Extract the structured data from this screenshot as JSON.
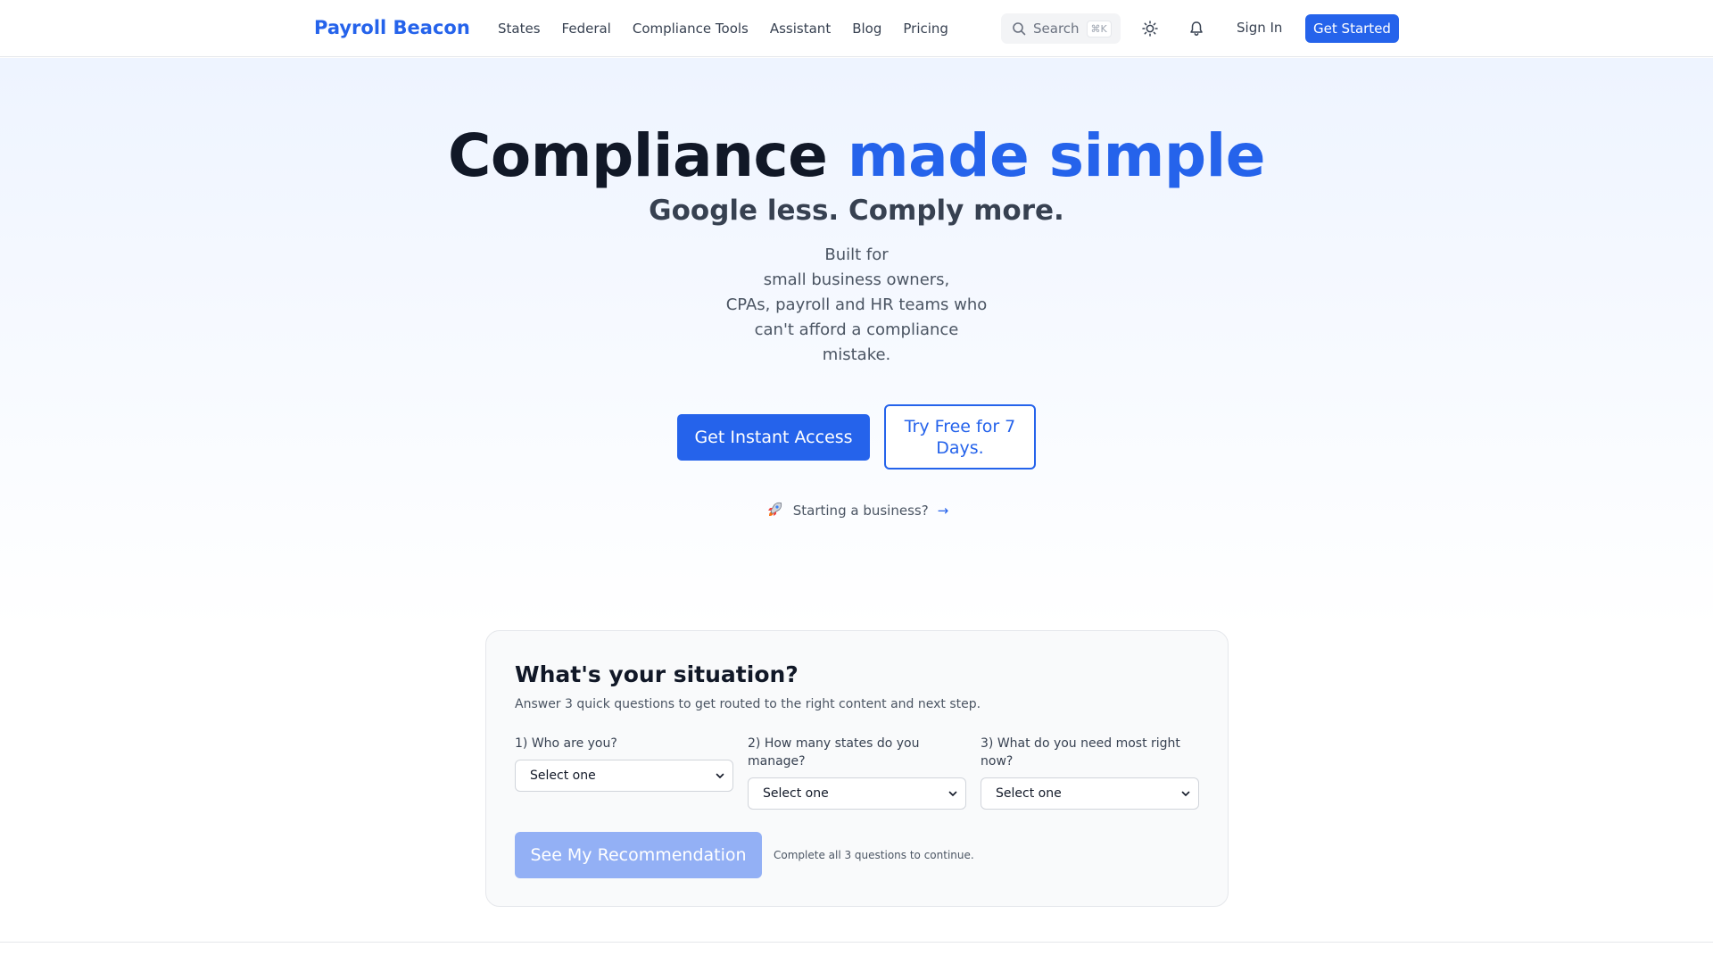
{
  "header": {
    "logo": "Payroll Beacon",
    "nav": [
      "States",
      "Federal",
      "Compliance Tools",
      "Assistant",
      "Blog",
      "Pricing"
    ],
    "search": {
      "label": "Search",
      "shortcut": "⌘K"
    },
    "icons": {
      "search": "search-icon",
      "theme": "sun-icon",
      "notifications": "bell-icon"
    },
    "sign_in": "Sign In",
    "get_started": "Get Started"
  },
  "hero": {
    "title_part1": "Compliance",
    "title_accent": "made simple",
    "subtitle": "Google less. Comply more.",
    "description_lines": [
      "Built for",
      "small business owners,",
      "CPAs, payroll and HR teams who",
      "can't afford a compliance",
      "mistake."
    ],
    "cta_primary": "Get Instant Access",
    "cta_secondary": "Try Free for 7 Days.",
    "starting_link": "Starting a business?",
    "starting_arrow": "→",
    "starting_icon": "rocket-icon"
  },
  "quiz": {
    "title": "What's your situation?",
    "description": "Answer 3 quick questions to get routed to the right content and next step.",
    "questions": [
      {
        "label": "1) Who are you?",
        "selected": "Select one"
      },
      {
        "label": "2) How many states do you manage?",
        "selected": "Select one"
      },
      {
        "label": "3) What do you need most right now?",
        "selected": "Select one"
      }
    ],
    "submit": "See My Recommendation",
    "hint": "Complete all 3 questions to continue."
  },
  "colors": {
    "accent": "#2563eb",
    "disabled_button": "#93b0f5",
    "heading": "#111827",
    "hero_gradient_top": "#eef4ff"
  }
}
